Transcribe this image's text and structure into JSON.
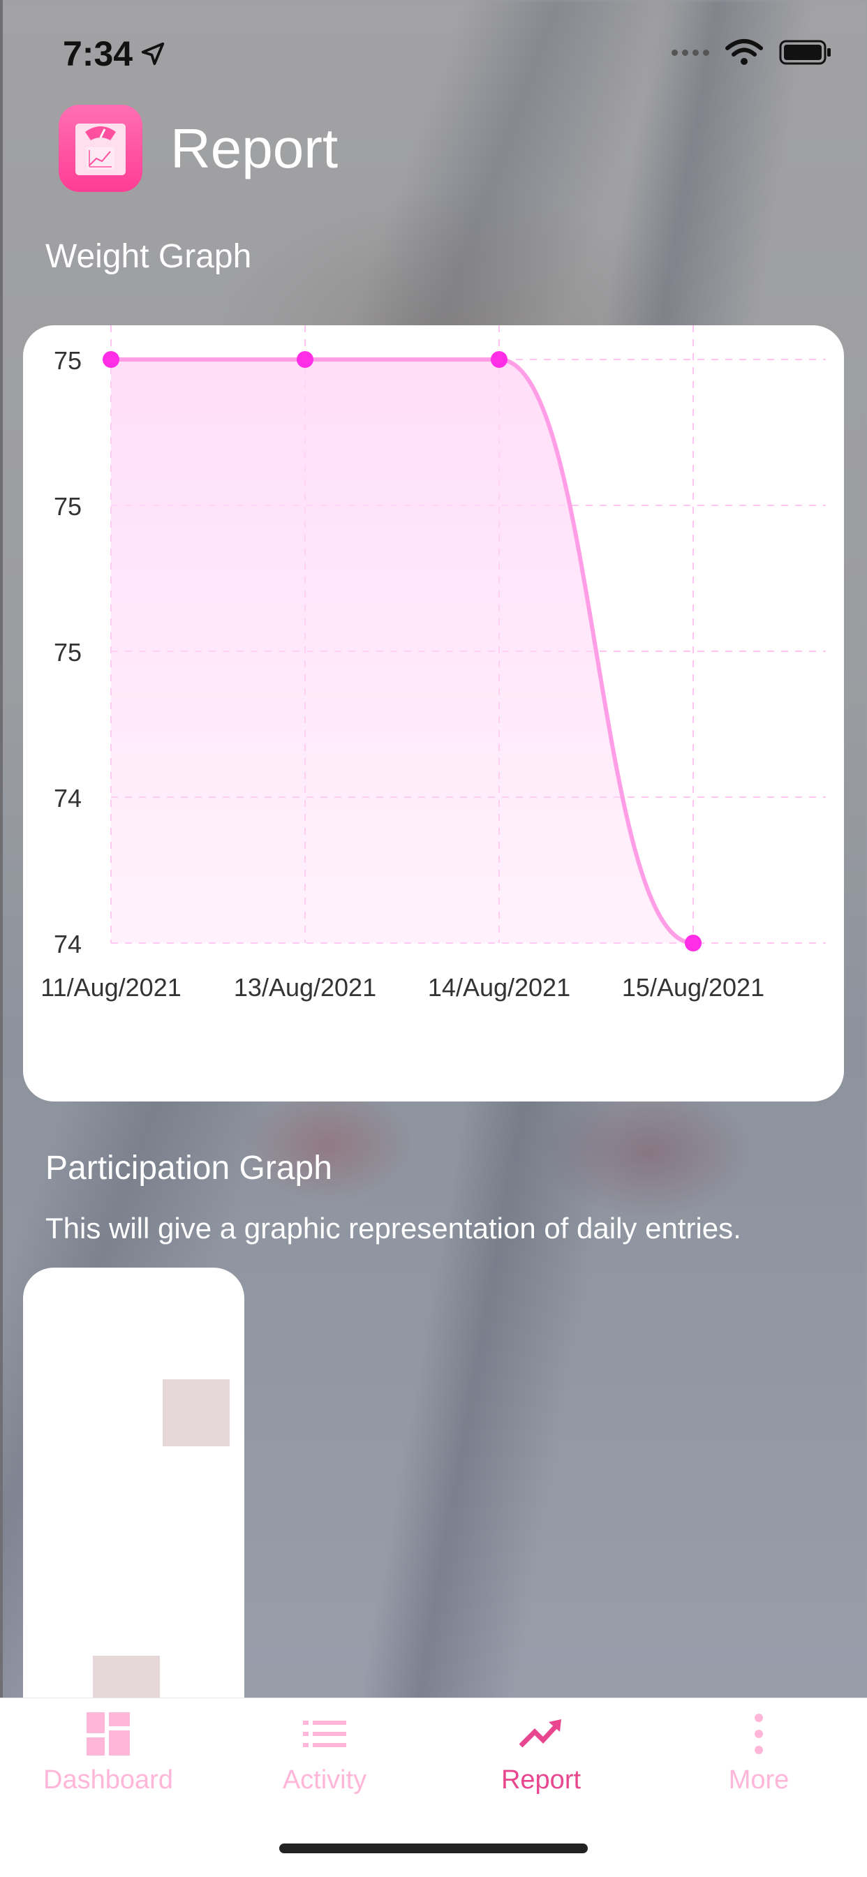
{
  "status_bar": {
    "time": "7:34",
    "icons": [
      "location-arrow-icon",
      "cellular-dots-icon",
      "wifi-icon",
      "battery-icon"
    ]
  },
  "header": {
    "title": "Report",
    "app_icon": "scale-chart-icon"
  },
  "weight_section": {
    "title": "Weight Graph"
  },
  "chart_data": {
    "type": "area",
    "categories": [
      "11/Aug/2021",
      "13/Aug/2021",
      "14/Aug/2021",
      "15/Aug/2021"
    ],
    "series": [
      {
        "values": [
          75,
          75,
          75,
          74
        ]
      }
    ],
    "y_tick_labels": [
      "75",
      "75",
      "75",
      "74",
      "74"
    ],
    "ylim": [
      74,
      75
    ],
    "grid": true,
    "line_color": "#ff9de6",
    "point_color": "#ff2ee6",
    "fill_color": "#ffd9f7"
  },
  "participation_section": {
    "title": "Participation Graph",
    "description": "This will give a graphic representation of daily entries."
  },
  "tab_bar": {
    "items": [
      {
        "label": "Dashboard",
        "icon": "dashboard-grid-icon",
        "active": false
      },
      {
        "label": "Activity",
        "icon": "list-icon",
        "active": false
      },
      {
        "label": "Report",
        "icon": "trending-up-icon",
        "active": true
      },
      {
        "label": "More",
        "icon": "vertical-dots-icon",
        "active": false
      }
    ]
  },
  "colors": {
    "accent": "#e8478f",
    "tab_inactive": "#ffb6d9",
    "app_icon": "#ff4f9f"
  }
}
